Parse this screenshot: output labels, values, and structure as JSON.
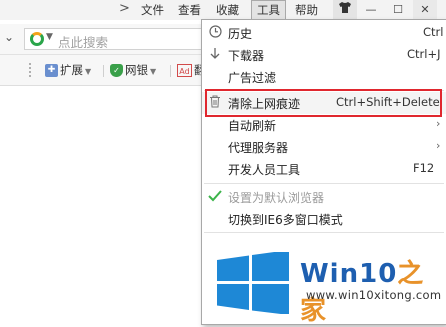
{
  "menubar": {
    "chevron": ">",
    "items": [
      "文件",
      "查看",
      "收藏",
      "工具",
      "帮助"
    ],
    "window_controls": [
      "—",
      "☐",
      "✕"
    ]
  },
  "search": {
    "placeholder": "点此搜索"
  },
  "favbar": {
    "extensions_label": "扩展",
    "bank_label": "网银",
    "ad_icon_text": "Ad",
    "translate_partial": "翻"
  },
  "dropdown": {
    "items": [
      {
        "label": "历史",
        "shortcut": "Ctrl",
        "icon": "clock-icon"
      },
      {
        "label": "下载器",
        "shortcut": "Ctrl+J",
        "icon": "download-arrow-icon"
      },
      {
        "label": "广告过滤",
        "shortcut": "",
        "icon": ""
      },
      {
        "label": "清除上网痕迹",
        "shortcut": "Ctrl+Shift+Delete",
        "icon": "trash-icon"
      },
      {
        "label": "自动刷新",
        "shortcut": "",
        "icon": ""
      },
      {
        "label": "代理服务器",
        "shortcut": "",
        "icon": ""
      },
      {
        "label": "开发人员工具",
        "shortcut": "F12",
        "icon": ""
      },
      {
        "label": "设置为默认浏览器",
        "shortcut": "",
        "icon": "checkmark-icon"
      },
      {
        "label": "切换到IE6多窗口模式",
        "shortcut": "",
        "icon": ""
      }
    ]
  },
  "watermark": {
    "title_en": "Win10",
    "title_zh": "之家",
    "url": "www.win10xitong.com"
  },
  "colors": {
    "highlight_box": "#e0272e",
    "watermark_blue": "#1e5fb0",
    "watermark_orange": "#e8922a",
    "check_green": "#3cb44a"
  }
}
